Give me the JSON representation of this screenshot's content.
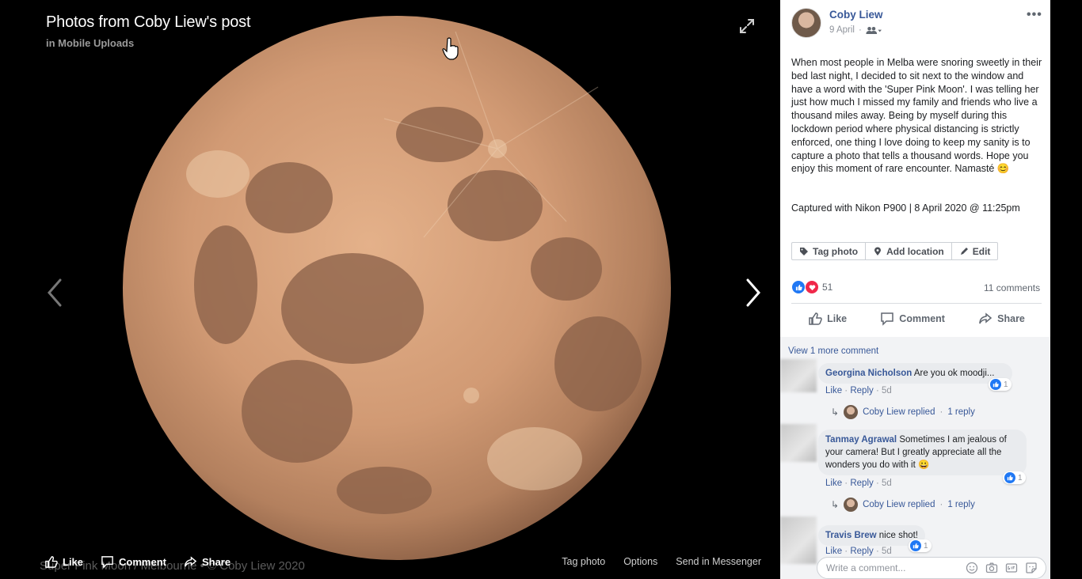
{
  "viewer": {
    "title": "Photos from Coby Liew's post",
    "subtitle": "in Mobile Uploads",
    "watermark": "Super Pink Moon / Melbourne • © Coby Liew 2020",
    "actions": {
      "like": "Like",
      "comment": "Comment",
      "share": "Share"
    },
    "right_actions": {
      "tag_photo": "Tag photo",
      "options": "Options",
      "send": "Send in Messenger"
    }
  },
  "post": {
    "author": "Coby Liew",
    "date": "9 April",
    "audience_icon": "friends-icon",
    "text": "When most people in Melba were snoring sweetly in their bed last night, I decided to sit next to the window and have a word with the 'Super Pink Moon'. I was telling her just how much I missed my family and friends who live a thousand miles away. Being by myself during this lockdown period where physical distancing is strictly enforced, one thing I love doing to keep my sanity is to capture a photo that tells a thousand words. Hope you enjoy this moment of rare encounter. Namasté 😊",
    "caption": "Captured with Nikon P900 | 8 April 2020 @ 11:25pm",
    "tools": {
      "tag_photo": "Tag photo",
      "add_location": "Add location",
      "edit": "Edit"
    },
    "reaction_count": "51",
    "comments_count": "11 comments",
    "actions": {
      "like": "Like",
      "comment": "Comment",
      "share": "Share"
    }
  },
  "comments": {
    "view_more": "View 1 more comment",
    "items": [
      {
        "name": "Georgina Nicholson",
        "text": "Are you ok moodji...",
        "like": "Like",
        "reply": "Reply",
        "age": "5d",
        "likes": "1",
        "reply_by": "Coby Liew replied",
        "reply_count": "1 reply"
      },
      {
        "name": "Tanmay Agrawal",
        "text": "Sometimes I am jealous of your camera! But I greatly appreciate all the wonders you do with it 😀",
        "like": "Like",
        "reply": "Reply",
        "age": "5d",
        "likes": "1",
        "reply_by": "Coby Liew replied",
        "reply_count": "1 reply"
      },
      {
        "name": "Travis Brew",
        "text": "nice shot!",
        "like": "Like",
        "reply": "Reply",
        "age": "5d",
        "likes": "1"
      }
    ],
    "write_placeholder": "Write a comment..."
  },
  "colors": {
    "link": "#385898",
    "like_blue": "#2078f4",
    "love_red": "#f0284a",
    "moon": "#d19a74"
  }
}
